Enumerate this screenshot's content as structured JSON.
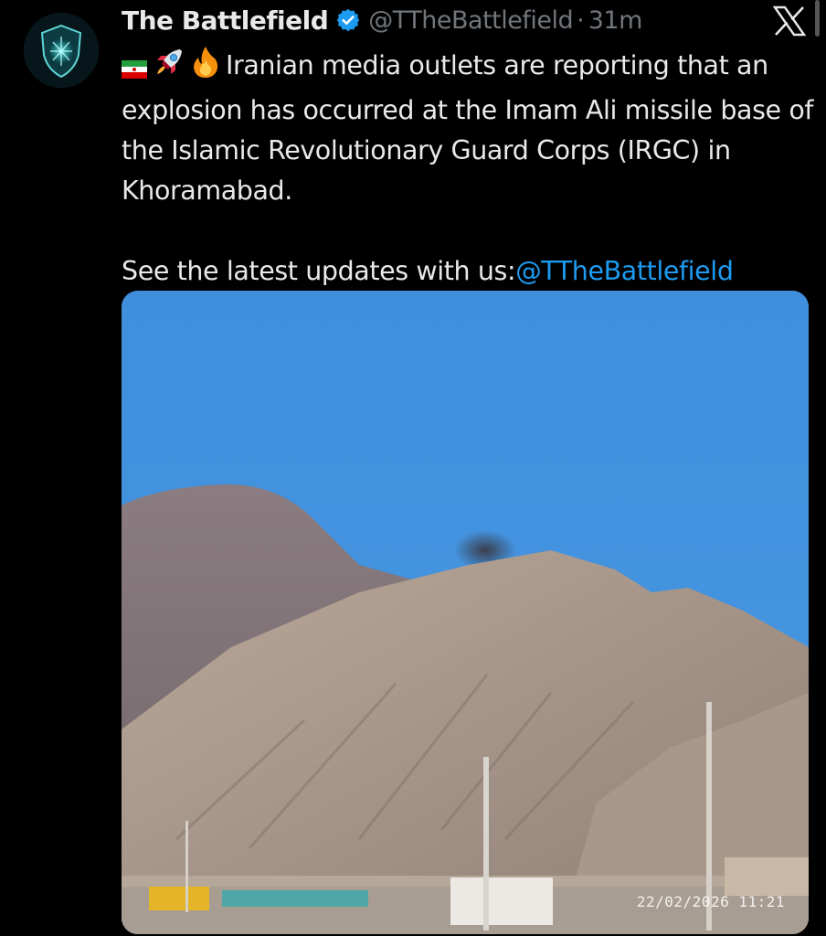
{
  "tweet": {
    "author_name": "The Battlefield",
    "handle": "@TTheBattlefield",
    "separator": "·",
    "time": "31m",
    "text_line1": "Iranian media outlets are reporting that an explosion has occurred at the Imam Ali missile base of the Islamic Revolutionary Guard Corps (IRGC) in Khoramabad.",
    "text_cta": "See the latest updates with  us:",
    "cta_mention": "@TTheBattlefield",
    "emojis": [
      "iran-flag-icon",
      "rocket-icon",
      "fire-icon"
    ]
  },
  "media": {
    "timestamp": "22/02/2026  11:21"
  },
  "colors": {
    "background": "#000000",
    "text": "#e7e9ea",
    "muted": "#71767b",
    "link": "#1d9bf0",
    "verified": "#1d9bf0"
  }
}
